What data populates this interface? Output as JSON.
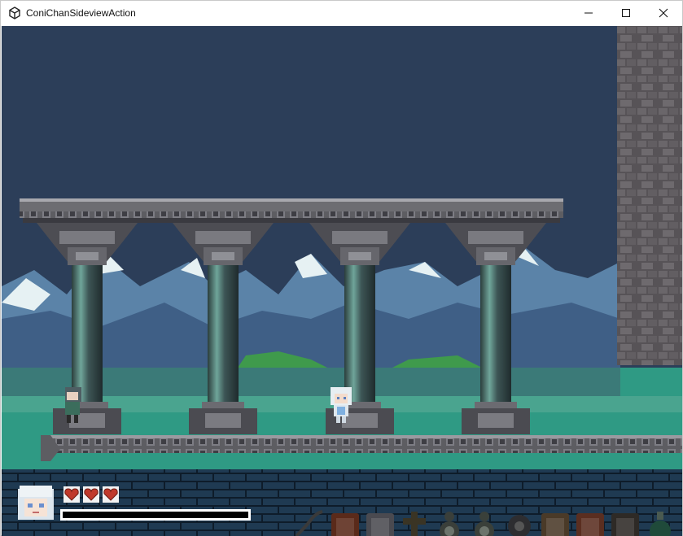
{
  "window": {
    "title": "ConiChanSideviewAction"
  },
  "hud": {
    "hearts": 3,
    "bar_fill": 0.0,
    "items": [
      "whip-icon",
      "boot-icon",
      "gauntlet-icon",
      "cross-icon",
      "potion-small-icon",
      "potion-bag-icon",
      "gear-icon",
      "scroll-icon",
      "book-icon",
      "chest-icon",
      "flask-icon"
    ]
  },
  "colors": {
    "sky": "#2c3e59",
    "wall": "#545054",
    "ground": "#2f9a84",
    "hud_bg": "#1c3348"
  }
}
